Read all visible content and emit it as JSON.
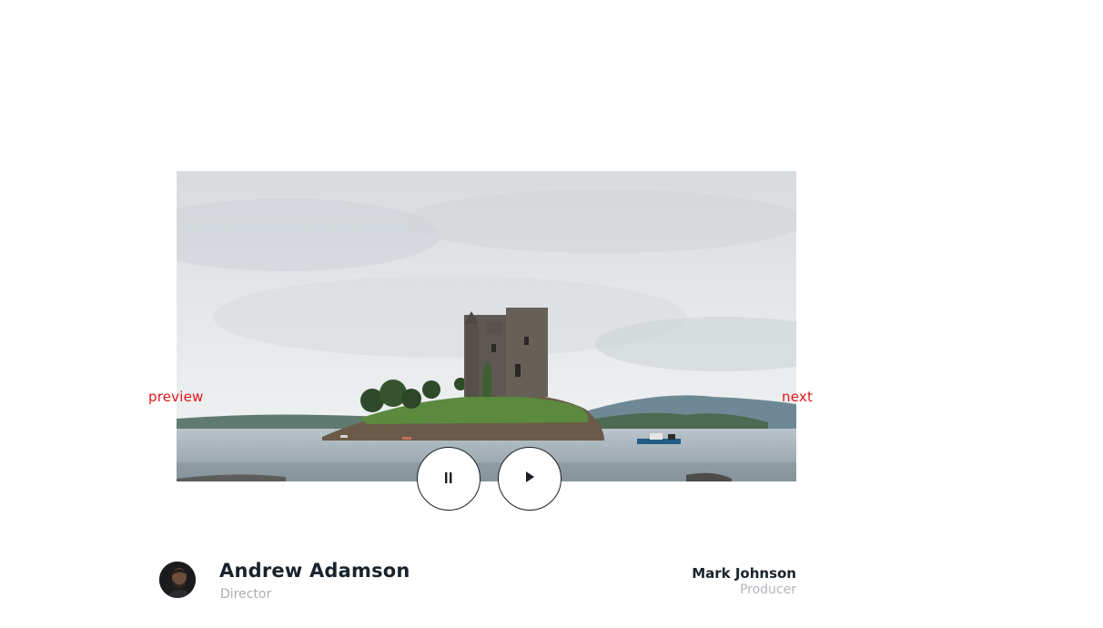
{
  "slider": {
    "image_alt": "Castle on a small island in a loch under an overcast sky",
    "prev_label": "preview",
    "next_label": "next",
    "link_color": "#e0161b"
  },
  "controls": {
    "pause_icon": "pause-icon",
    "play_icon": "play-icon"
  },
  "credits": {
    "director": {
      "name": "Andrew Adamson",
      "role": "Director",
      "avatar_icon": "avatar-photo"
    },
    "producer": {
      "name": "Mark Johnson",
      "role": "Producer"
    }
  }
}
